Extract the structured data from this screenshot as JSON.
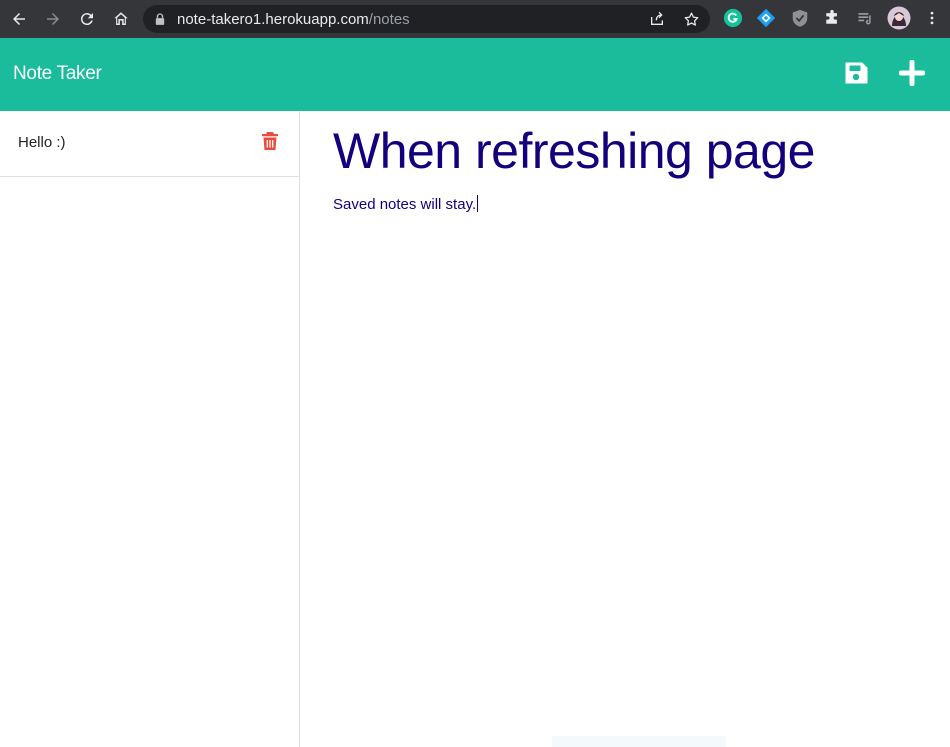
{
  "browser": {
    "url_host": "note-takero1.herokuapp.com",
    "url_path": "/notes",
    "icons": [
      "back-icon",
      "forward-icon",
      "reload-icon",
      "home-icon",
      "lock-icon",
      "share-icon",
      "star-icon",
      "grammarly-icon",
      "extension-diamond-icon",
      "shield-extension-icon",
      "puzzle-icon",
      "reading-list-icon",
      "profile-avatar",
      "menu-dots-icon"
    ]
  },
  "app": {
    "brand": "Note Taker",
    "accent_color": "#1abc9c",
    "note_color": "#13007c",
    "delete_color": "#e74c3c"
  },
  "notes": [
    {
      "title": "Hello :)"
    }
  ],
  "editor": {
    "title": "When refreshing page",
    "text": "Saved notes will stay."
  }
}
